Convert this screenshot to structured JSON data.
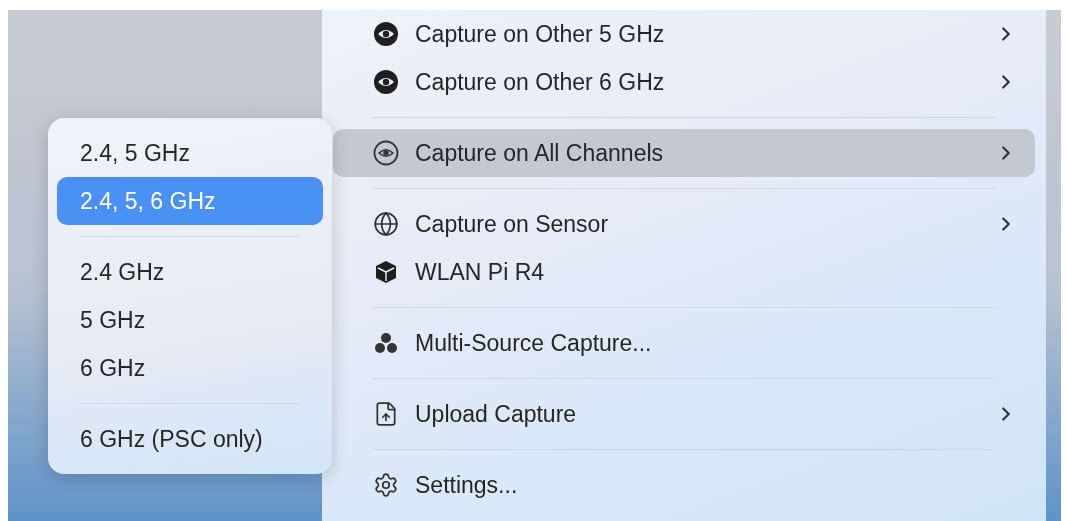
{
  "menu": {
    "groups": [
      [
        {
          "label": "Capture on Other 5 GHz",
          "kind": "eye-badge",
          "submenu": true,
          "selected": false
        },
        {
          "label": "Capture on Other 6 GHz",
          "kind": "eye-badge",
          "submenu": true,
          "selected": false
        }
      ],
      [
        {
          "label": "Capture on All Channels",
          "kind": "eye-ring",
          "submenu": true,
          "selected": true
        }
      ],
      [
        {
          "label": "Capture on Sensor",
          "kind": "globe",
          "submenu": true,
          "selected": false
        },
        {
          "label": "WLAN Pi R4",
          "kind": "cube",
          "submenu": false,
          "selected": false
        }
      ],
      [
        {
          "label": "Multi-Source Capture...",
          "kind": "nodes",
          "submenu": false,
          "selected": false
        }
      ],
      [
        {
          "label": "Upload Capture",
          "kind": "file-upload",
          "submenu": true,
          "selected": false
        }
      ],
      [
        {
          "label": "Settings...",
          "kind": "gear",
          "submenu": false,
          "selected": false
        }
      ]
    ]
  },
  "submenu": {
    "groups": [
      [
        {
          "label": "2.4, 5 GHz",
          "selected": false
        },
        {
          "label": "2.4, 5, 6 GHz",
          "selected": true
        }
      ],
      [
        {
          "label": "2.4 GHz",
          "selected": false
        },
        {
          "label": "5 GHz",
          "selected": false
        },
        {
          "label": "6 GHz",
          "selected": false
        }
      ],
      [
        {
          "label": "6 GHz (PSC only)",
          "selected": false
        }
      ]
    ]
  }
}
